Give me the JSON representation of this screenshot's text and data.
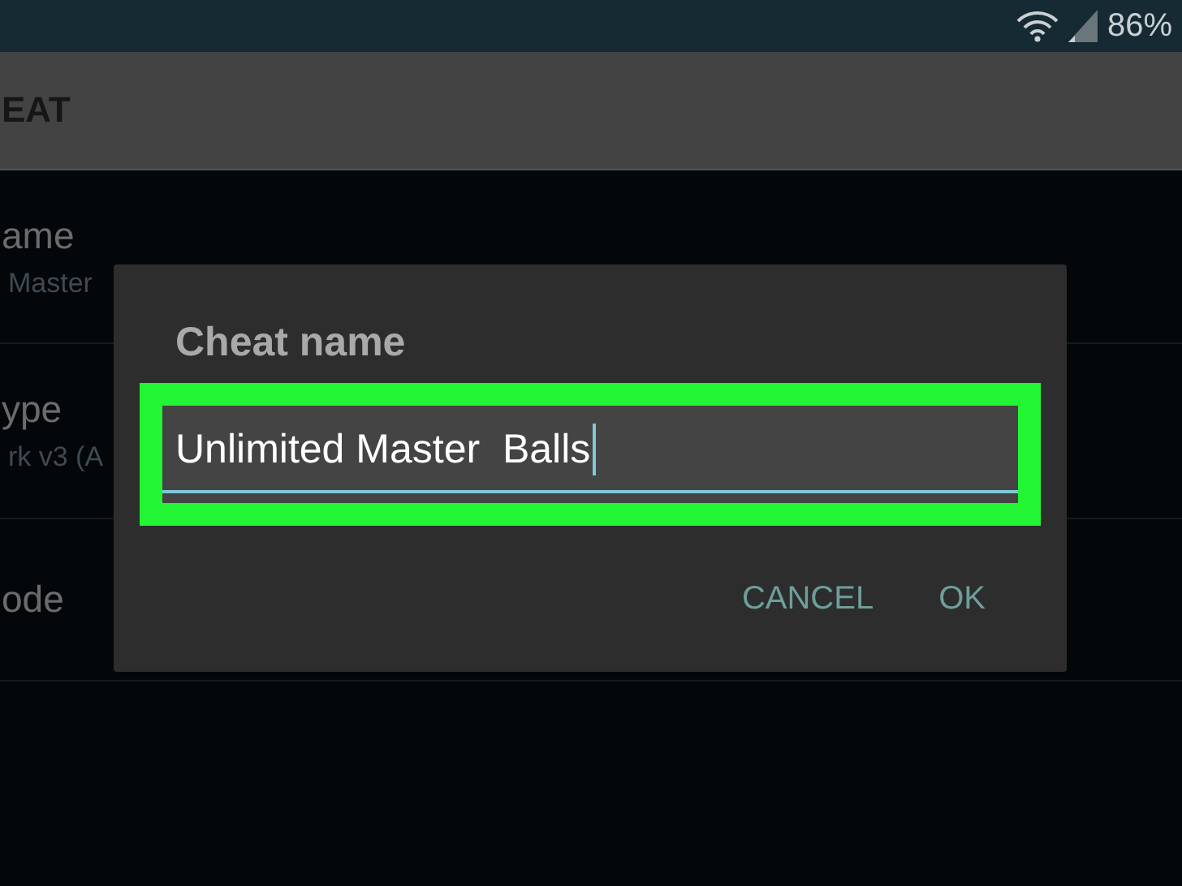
{
  "status_bar": {
    "battery": "86%"
  },
  "app_bar": {
    "title": "EAT"
  },
  "settings": [
    {
      "title": "ame",
      "subtitle": "Master"
    },
    {
      "title": "ype",
      "subtitle": "rk v3 (A"
    },
    {
      "title": "ode"
    }
  ],
  "dialog": {
    "title": "Cheat name",
    "highlighted": true,
    "field": {
      "value": "Unlimited Master  Balls",
      "focused": true
    },
    "buttons": [
      "CANCEL",
      "OK"
    ]
  }
}
